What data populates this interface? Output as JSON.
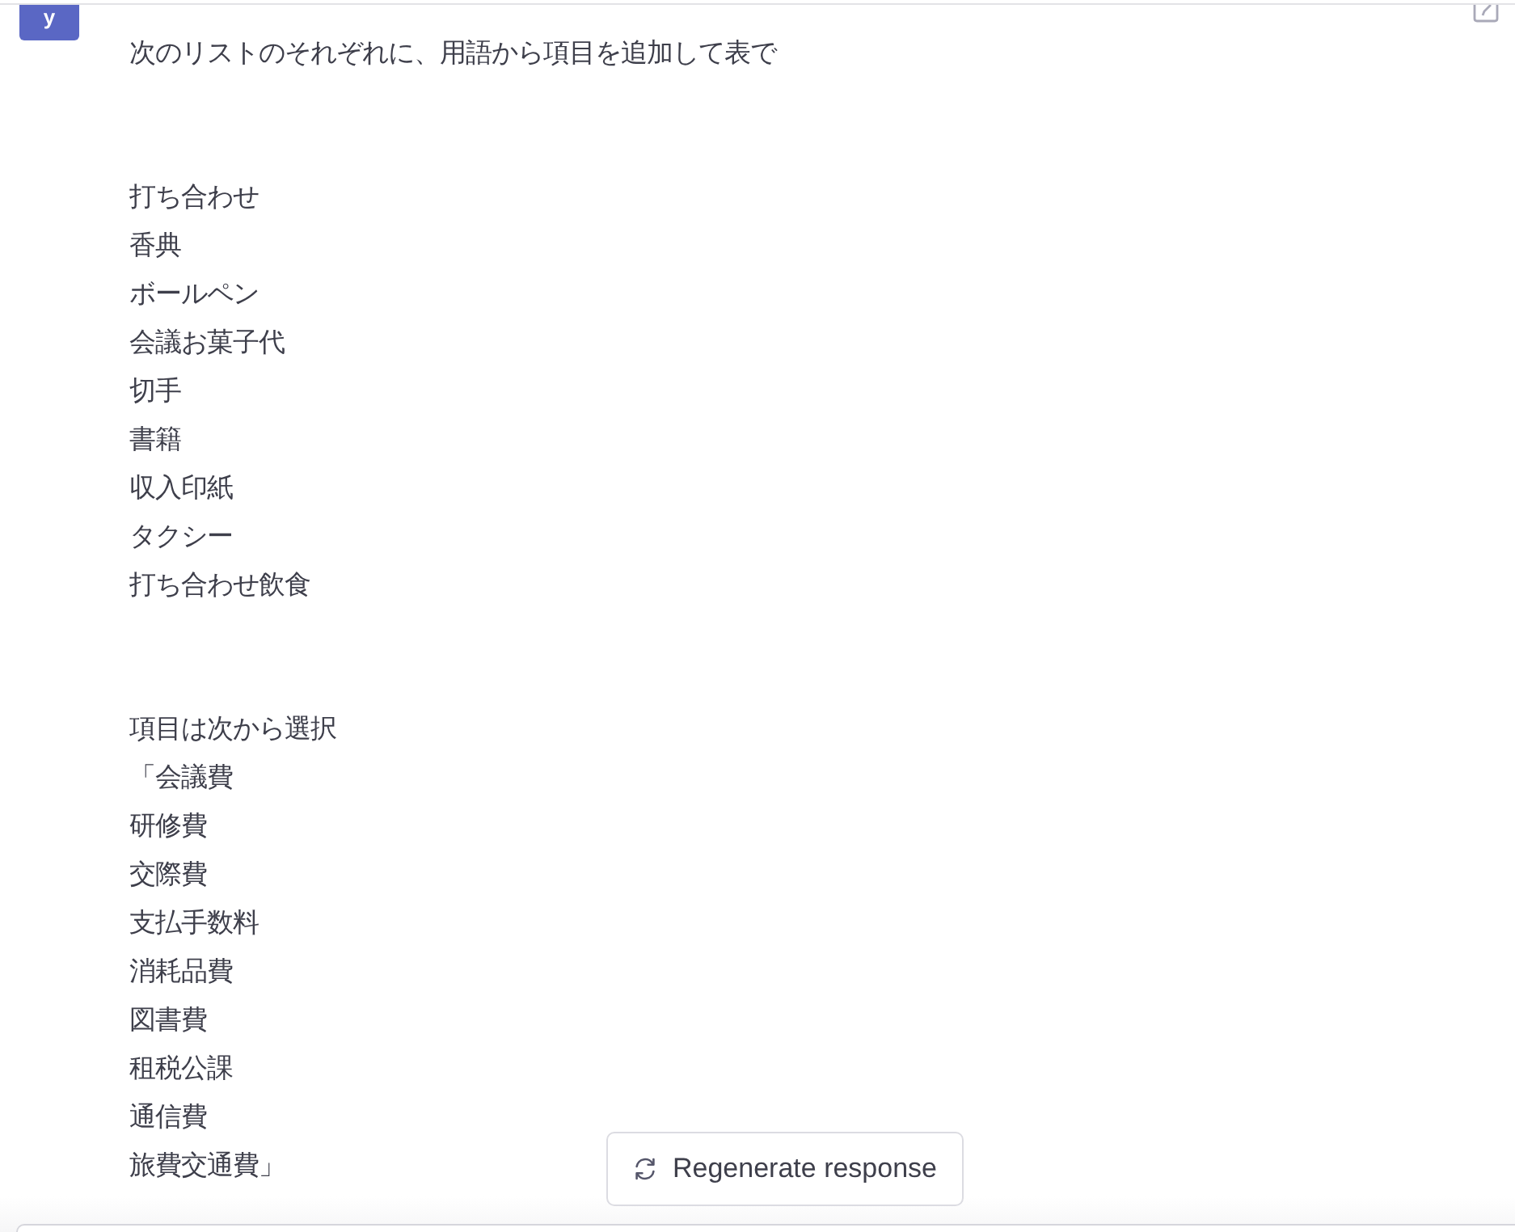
{
  "message": {
    "avatar_letter": "y",
    "groups": [
      [
        "次のリストのそれぞれに、用語から項目を追加して表で"
      ],
      [
        "打ち合わせ",
        "香典",
        "ボールペン",
        "会議お菓子代",
        "切手",
        "書籍",
        "収入印紙",
        "タクシー",
        "打ち合わせ飲食"
      ],
      [
        "項目は次から選択",
        "「会議費",
        "研修費",
        "交際費",
        "支払手数料",
        "消耗品費",
        "図書費",
        "租税公課",
        "通信費",
        "旅費交通費」"
      ]
    ]
  },
  "regenerate_button": {
    "label": "Regenerate response"
  }
}
